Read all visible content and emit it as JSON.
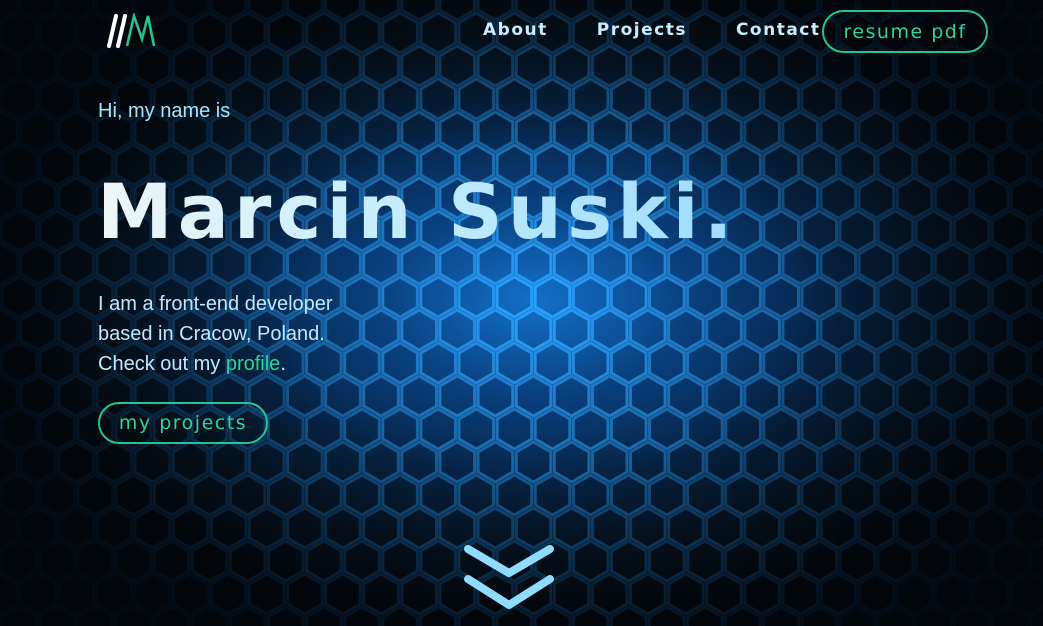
{
  "header": {
    "logo_icon": "mm-logo-icon",
    "nav": [
      {
        "label": "About"
      },
      {
        "label": "Projects"
      },
      {
        "label": "Contact"
      }
    ],
    "resume_label": "resume pdf"
  },
  "hero": {
    "greeting": "Hi, my name is",
    "name": "Marcin Suski.",
    "intro_line1": "I am a front-end developer",
    "intro_line2": "based in Cracow, Poland.",
    "intro_line3_prefix": "Check out my ",
    "intro_link": "profile",
    "intro_line3_suffix": ".",
    "projects_label": "my projects",
    "scroll_icon": "double-chevron-down-icon"
  },
  "colors": {
    "accent": "#23c48f",
    "text_light": "#c9ecff",
    "background_glow": "#0c5aa8"
  }
}
